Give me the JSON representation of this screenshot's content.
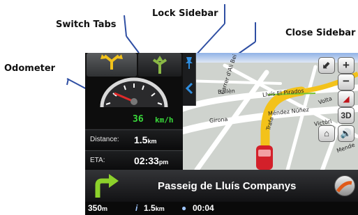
{
  "callouts": {
    "odometer": "Odometer",
    "switch_tabs": "Switch Tabs",
    "lock_sidebar": "Lock Sidebar",
    "close_sidebar": "Close Sidebar"
  },
  "odometer": {
    "speed": "36",
    "speed_unit": "km/h"
  },
  "distance": {
    "label": "Distance:",
    "value": "1.5",
    "unit": "km"
  },
  "eta": {
    "label": "ETA:",
    "value": "02:33",
    "unit": "pm"
  },
  "map": {
    "streets": [
      "Bailèn",
      "Lluís El Pirados",
      "Volta",
      "Méndez Núñez",
      "Girona",
      "Carrer d'Ali Bei",
      "Trafa",
      "Victòri",
      "Mende"
    ],
    "view_mode": "3D",
    "zoom_in": "+",
    "zoom_out": "−"
  },
  "street_name": "Passeig de Lluís Companys",
  "bottom_bar": {
    "turn_distance": "350",
    "turn_distance_unit": "m",
    "info_distance": "1.5",
    "info_distance_unit": "km",
    "time": "00:04"
  },
  "colors": {
    "accent_green": "#39d83a",
    "route_yellow": "#f3c21a",
    "lock_blue": "#2f8ee0"
  }
}
